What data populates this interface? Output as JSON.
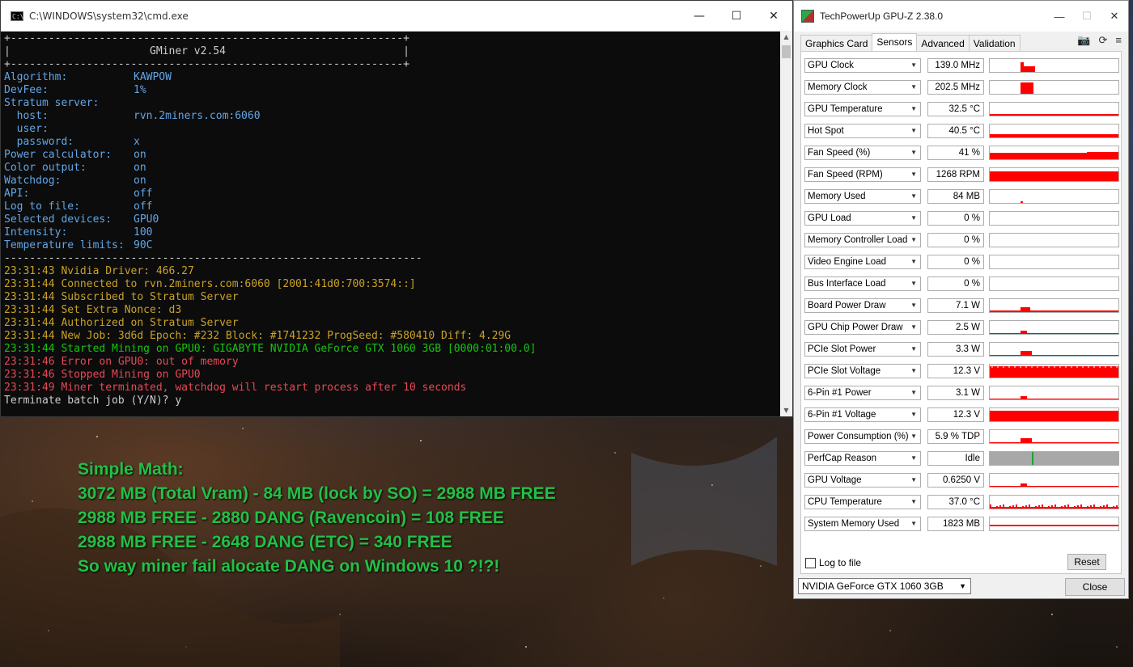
{
  "cmd": {
    "title": "C:\\WINDOWS\\system32\\cmd.exe",
    "border_line": "+--------------------------------------------------------------+",
    "banner": "|                      GMiner v2.54                            |",
    "config": [
      {
        "k": "Algorithm:",
        "v": "KAWPOW",
        "indent": false
      },
      {
        "k": "DevFee:",
        "v": "1%",
        "indent": false
      },
      {
        "k": "Stratum server:",
        "v": "",
        "indent": false
      },
      {
        "k": "host:",
        "v": "rvn.2miners.com:6060",
        "indent": true
      },
      {
        "k": "user:",
        "v": "",
        "indent": true
      },
      {
        "k": "password:",
        "v": "x",
        "indent": true
      },
      {
        "k": "Power calculator:",
        "v": "on",
        "indent": false
      },
      {
        "k": "Color output:",
        "v": "on",
        "indent": false
      },
      {
        "k": "Watchdog:",
        "v": "on",
        "indent": false
      },
      {
        "k": "API:",
        "v": "off",
        "indent": false
      },
      {
        "k": "Log to file:",
        "v": "off",
        "indent": false
      },
      {
        "k": "Selected devices:",
        "v": "GPU0",
        "indent": false
      },
      {
        "k": "Intensity:",
        "v": "100",
        "indent": false
      },
      {
        "k": "Temperature limits:",
        "v": "90C",
        "indent": false
      }
    ],
    "separator": "------------------------------------------------------------------",
    "log": [
      {
        "t": "23:31:43 Nvidia Driver: 466.27",
        "c": "log"
      },
      {
        "t": "23:31:44 Connected to rvn.2miners.com:6060 [2001:41d0:700:3574::]",
        "c": "log"
      },
      {
        "t": "23:31:44 Subscribed to Stratum Server",
        "c": "log"
      },
      {
        "t": "23:31:44 Set Extra Nonce: d3",
        "c": "log"
      },
      {
        "t": "23:31:44 Authorized on Stratum Server",
        "c": "log"
      },
      {
        "t": "23:31:44 New Job: 3d6d Epoch: #232 Block: #1741232 ProgSeed: #580410 Diff: 4.29G",
        "c": "log"
      },
      {
        "t": "23:31:44 Started Mining on GPU0: GIGABYTE NVIDIA GeForce GTX 1060 3GB [0000:01:00.0]",
        "c": "ok"
      },
      {
        "t": "23:31:46 Error on GPU0: out of memory",
        "c": "err"
      },
      {
        "t": "23:31:46 Stopped Mining on GPU0",
        "c": "err"
      },
      {
        "t": "23:31:49 Miner terminated, watchdog will restart process after 10 seconds",
        "c": "err"
      },
      {
        "t": "Terminate batch job (Y/N)? y",
        "c": "white"
      }
    ]
  },
  "note": {
    "lines": [
      "Simple Math:",
      "3072 MB (Total Vram) - 84 MB (lock by SO) = 2988 MB FREE",
      "2988 MB FREE - 2880 DANG (Ravencoin) = 108 FREE",
      "2988 MB FREE - 2648 DANG (ETC) = 340 FREE",
      "So way miner fail alocate DANG on Windows 10 ?!?!"
    ]
  },
  "gpuz": {
    "title": "TechPowerUp GPU-Z 2.38.0",
    "tabs": [
      "Graphics Card",
      "Sensors",
      "Advanced",
      "Validation"
    ],
    "active_tab": "Sensors",
    "sensors": [
      {
        "name": "GPU Clock",
        "value": "139.0 MHz",
        "graph": "spike-tall"
      },
      {
        "name": "Memory Clock",
        "value": "202.5 MHz",
        "graph": "block-tall"
      },
      {
        "name": "GPU Temperature",
        "value": "32.5 °C",
        "graph": "low-line"
      },
      {
        "name": "Hot Spot",
        "value": "40.5 °C",
        "graph": "low-line2"
      },
      {
        "name": "Fan Speed (%)",
        "value": "41 %",
        "graph": "mid-fill"
      },
      {
        "name": "Fan Speed (RPM)",
        "value": "1268 RPM",
        "graph": "high-fill"
      },
      {
        "name": "Memory Used",
        "value": "84 MB",
        "graph": "tiny"
      },
      {
        "name": "GPU Load",
        "value": "0 %",
        "graph": "none"
      },
      {
        "name": "Memory Controller Load",
        "value": "0 %",
        "graph": "none"
      },
      {
        "name": "Video Engine Load",
        "value": "0 %",
        "graph": "none"
      },
      {
        "name": "Bus Interface Load",
        "value": "0 %",
        "graph": "none"
      },
      {
        "name": "Board Power Draw",
        "value": "7.1 W",
        "graph": "small-bump"
      },
      {
        "name": "GPU Chip Power Draw",
        "value": "2.5 W",
        "graph": "small-bump2"
      },
      {
        "name": "PCIe Slot Power",
        "value": "3.3 W",
        "graph": "small-bump3"
      },
      {
        "name": "PCIe Slot Voltage",
        "value": "12.3 V",
        "graph": "full-fill"
      },
      {
        "name": "6-Pin #1 Power",
        "value": "3.1 W",
        "graph": "small-bump2"
      },
      {
        "name": "6-Pin #1 Voltage",
        "value": "12.3 V",
        "graph": "full-fill2"
      },
      {
        "name": "Power Consumption (%)",
        "value": "5.9 % TDP",
        "graph": "small-bump3"
      },
      {
        "name": "PerfCap Reason",
        "value": "Idle",
        "graph": "perfcap"
      },
      {
        "name": "GPU Voltage",
        "value": "0.6250 V",
        "graph": "small-bump2"
      },
      {
        "name": "CPU Temperature",
        "value": "37.0 °C",
        "graph": "noisy"
      },
      {
        "name": "System Memory Used",
        "value": "1823 MB",
        "graph": "flat-mid"
      }
    ],
    "log_to_file": "Log to file",
    "reset": "Reset",
    "device": "NVIDIA GeForce GTX 1060 3GB",
    "close": "Close",
    "graph_color": "#ff0000",
    "perfcap_color": "#a8a8a8"
  }
}
